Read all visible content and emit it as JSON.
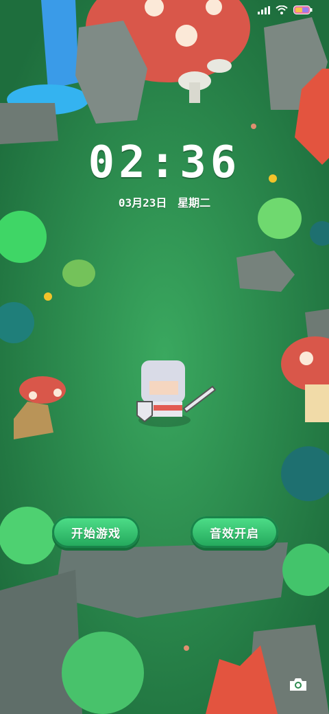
{
  "status_bar": {
    "icons": [
      "signal-icon",
      "wifi-icon",
      "battery-icon"
    ],
    "battery_color": "#f080b0"
  },
  "lockscreen": {
    "time": "02:36",
    "date": "03月23日",
    "weekday": "星期二"
  },
  "buttons": {
    "start_game": "开始游戏",
    "sound_on": "音效开启"
  },
  "colors": {
    "accent_green": "#2fc56a",
    "background": "#2d8a4e"
  },
  "shortcut": {
    "icon": "camera-icon"
  }
}
